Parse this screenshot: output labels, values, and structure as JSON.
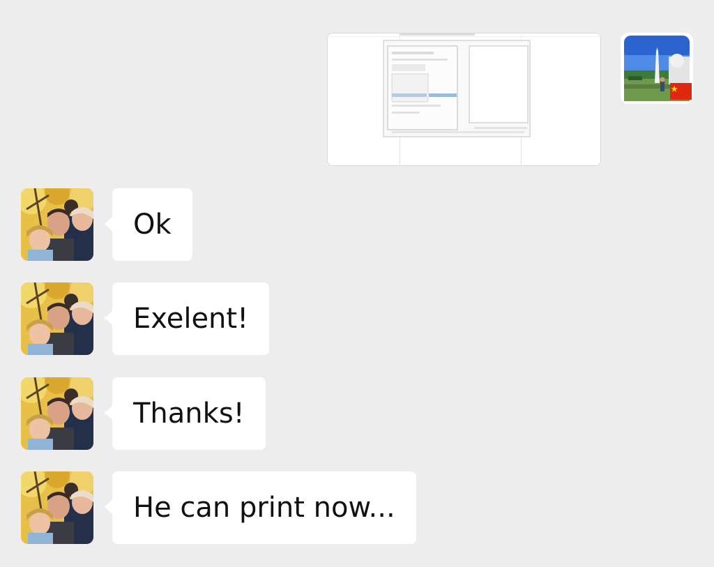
{
  "chat": {
    "outgoing_image": {
      "content": "screenshot-thumbnail"
    },
    "messages": [
      {
        "text": "Ok"
      },
      {
        "text": "Exelent!"
      },
      {
        "text": "Thanks!"
      },
      {
        "text": "He can print now..."
      }
    ]
  },
  "colors": {
    "background": "#ededed",
    "bubble": "#ffffff",
    "text": "#111111"
  }
}
